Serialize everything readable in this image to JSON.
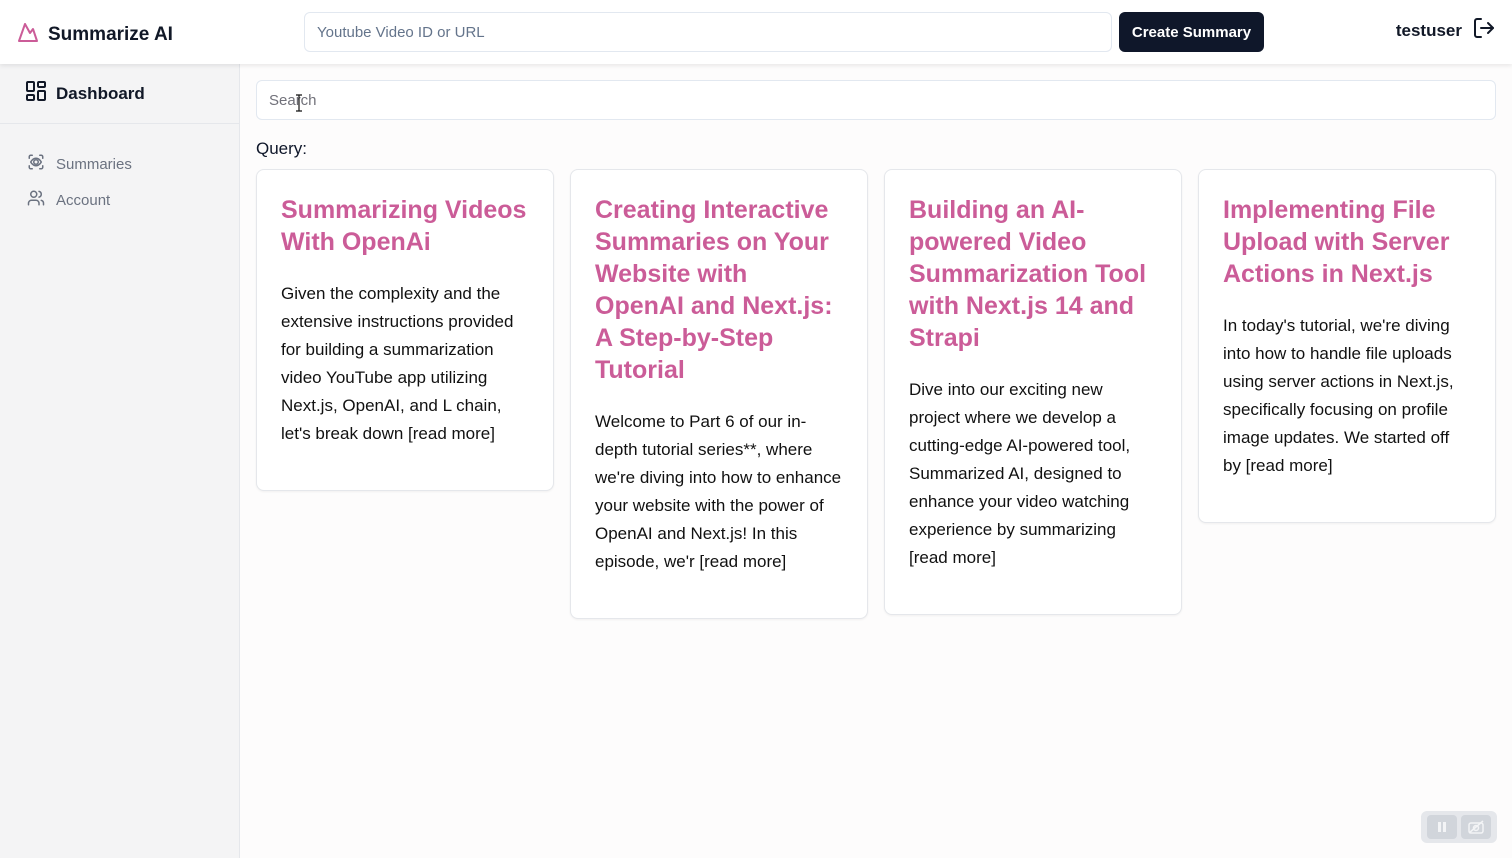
{
  "app": {
    "name": "Summarize AI",
    "brand_color": "#cb5c98"
  },
  "header": {
    "url_input_placeholder": "Youtube Video ID or URL",
    "create_button": "Create Summary",
    "username": "testuser"
  },
  "sidebar": {
    "dashboard": "Dashboard",
    "items": [
      {
        "label": "Summaries",
        "icon": "summaries-icon"
      },
      {
        "label": "Account",
        "icon": "users-icon"
      }
    ]
  },
  "main": {
    "search_placeholder": "Search",
    "query_label": "Query:",
    "cards": [
      {
        "title": "Summarizing Videos With OpenAi",
        "body": "Given the complexity and the extensive instructions provided for building a summarization video YouTube app utilizing Next.js, OpenAI, and L chain, let's break down [read more]"
      },
      {
        "title": "Creating Interactive Summaries on Your Website with OpenAI and Next.js: A Step-by-Step Tutorial",
        "body": "Welcome to Part 6 of our in-depth tutorial series**, where we're diving into how to enhance your website with the power of OpenAI and Next.js! In this episode, we'r [read more]"
      },
      {
        "title": "Building an AI-powered Video Summarization Tool with Next.js 14 and Strapi",
        "body": "Dive into our exciting new project where we develop a cutting-edge AI-powered tool, Summarized AI, designed to enhance your video watching experience by summarizing [read more]"
      },
      {
        "title": "Implementing File Upload with Server Actions in Next.js",
        "body": "In today's tutorial, we're diving into how to handle file uploads using server actions in Next.js, specifically focusing on profile image updates. We started off by [read more]"
      }
    ]
  }
}
